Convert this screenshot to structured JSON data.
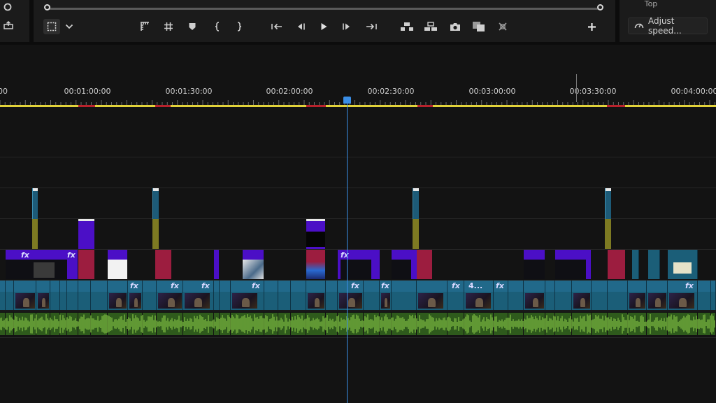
{
  "header": {
    "top_label": "Top",
    "adjust_speed_label": "Adjust speed..."
  },
  "toolbar": {
    "left_icons": [
      "playhead-circle-icon",
      "export-frame-icon"
    ],
    "tools": [
      {
        "name": "select-region-icon"
      },
      {
        "name": "chevron-down-icon"
      },
      {
        "name": "ruler-icon"
      },
      {
        "name": "grid-icon"
      },
      {
        "name": "marker-icon"
      },
      {
        "name": "mark-in-icon"
      },
      {
        "name": "mark-out-icon"
      },
      {
        "name": "go-to-in-icon"
      },
      {
        "name": "step-back-icon"
      },
      {
        "name": "play-icon"
      },
      {
        "name": "step-forward-icon"
      },
      {
        "name": "go-to-out-icon"
      },
      {
        "name": "lift-icon"
      },
      {
        "name": "extract-icon"
      },
      {
        "name": "camera-icon"
      },
      {
        "name": "comparison-view-icon"
      },
      {
        "name": "settings-wrench-icon"
      },
      {
        "name": "add-button-icon"
      }
    ]
  },
  "ruler": {
    "timecodes": [
      "00",
      "00:01:00:00",
      "00:01:30:00",
      "00:02:00:00",
      "00:02:30:00",
      "00:03:00:00",
      "00:03:30:00",
      "00:04:00:00"
    ]
  },
  "colors": {
    "playhead": "#3a8ee6",
    "work_area": "#e1d23a",
    "render_red": "#b8222c",
    "clip_purple": "#4b0fc6",
    "clip_crimson": "#9c1d3f",
    "clip_teal": "#1b5e78",
    "audio_green": "#6ea83a"
  },
  "clips": {
    "fx_badge": "fx",
    "truncated_label": "4..."
  }
}
